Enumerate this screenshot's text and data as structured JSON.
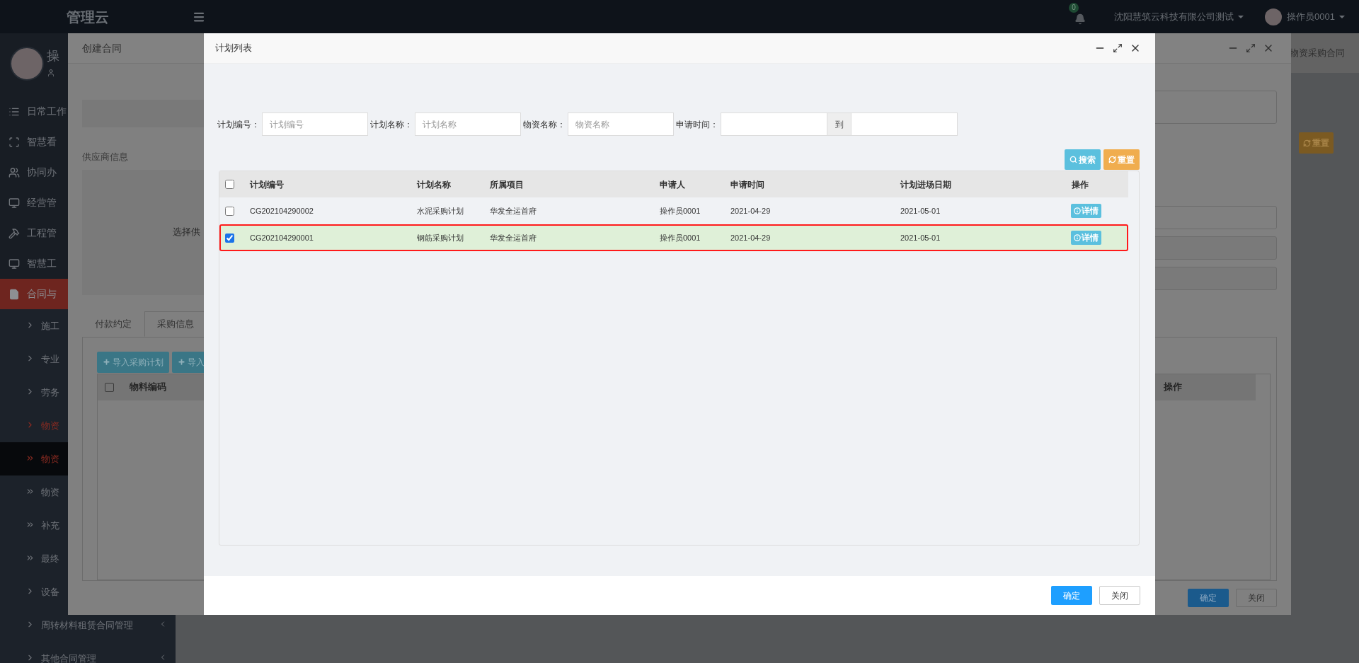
{
  "header": {
    "logo": "管理云",
    "notification_count": "0",
    "company": "沈阳慧筑云科技有限公司测试",
    "user": "操作员0001"
  },
  "sidebar": {
    "profile_name": "操",
    "items": [
      {
        "label": "日常工作",
        "selected": false
      },
      {
        "label": "智慧看",
        "selected": false
      },
      {
        "label": "协同办",
        "selected": false
      },
      {
        "label": "经营管",
        "selected": false
      },
      {
        "label": "工程管",
        "selected": false
      },
      {
        "label": "智慧工",
        "selected": false
      },
      {
        "label": "合同与",
        "selected": true,
        "children": [
          {
            "label": "施工",
            "kind": "folder",
            "highlighted": false,
            "selected": false
          },
          {
            "label": "专业",
            "kind": "folder",
            "highlighted": false,
            "selected": false
          },
          {
            "label": "劳务",
            "kind": "folder",
            "highlighted": false,
            "selected": false
          },
          {
            "label": "物资",
            "kind": "folder",
            "highlighted": true,
            "selected": false
          },
          {
            "label": "物资",
            "kind": "link",
            "highlighted": true,
            "selected": true
          },
          {
            "label": "物资",
            "kind": "link",
            "highlighted": false,
            "selected": false
          },
          {
            "label": "补充",
            "kind": "link",
            "highlighted": false,
            "selected": false
          },
          {
            "label": "最终",
            "kind": "link",
            "highlighted": false,
            "selected": false
          },
          {
            "label": "设备",
            "kind": "folder",
            "highlighted": false,
            "selected": false
          },
          {
            "label": "周转材料租赁合同管理",
            "kind": "folder",
            "highlighted": false,
            "selected": false
          },
          {
            "label": "其他合同管理",
            "kind": "folder",
            "highlighted": false,
            "selected": false
          }
        ]
      }
    ]
  },
  "page": {
    "tab_label": "物资采购合同",
    "reset_button": "重置"
  },
  "create_dialog": {
    "title": "创建合同",
    "supplier_section": "供应商信息",
    "supplier_label": "选择供",
    "tabs": [
      {
        "label": "付款约定",
        "selected": false
      },
      {
        "label": "采购信息",
        "selected": true
      }
    ],
    "buttons": [
      "导入采购计划",
      "导入"
    ],
    "header_checked": false,
    "table_columns": [
      "物料编码",
      "操作"
    ],
    "footer_buttons": [
      {
        "label": "确定",
        "kind": "primary"
      },
      {
        "label": "关闭",
        "kind": "default"
      }
    ]
  },
  "plan_dialog": {
    "title": "计划列表",
    "filters": [
      {
        "label": "计划编号：",
        "kind": "text",
        "placeholder": "计划编号"
      },
      {
        "label": "计划名称：",
        "kind": "text",
        "placeholder": "计划名称"
      },
      {
        "label": "物资名称：",
        "kind": "text",
        "placeholder": "物资名称"
      },
      {
        "label": "申请时间：",
        "kind": "range",
        "separator": "到"
      }
    ],
    "buttons": [
      {
        "label": "搜索",
        "kind": "search"
      },
      {
        "label": "重置",
        "kind": "reset"
      }
    ],
    "table": {
      "header_checked": false,
      "columns": [
        "计划编号",
        "计划名称",
        "所属项目",
        "申请人",
        "申请时间",
        "计划进场日期",
        "操作"
      ],
      "rows": [
        {
          "checked": false,
          "selected": false,
          "cells": [
            "CG202104290002",
            "水泥采购计划",
            "华发全运首府",
            "操作员0001",
            "2021-04-29",
            "2021-05-01"
          ],
          "action": "详情"
        },
        {
          "checked": true,
          "selected": true,
          "cells": [
            "CG202104290001",
            "钢筋采购计划",
            "华发全运首府",
            "操作员0001",
            "2021-04-29",
            "2021-05-01"
          ],
          "action": "详情"
        }
      ]
    },
    "footer_buttons": [
      {
        "label": "确定",
        "kind": "primary"
      },
      {
        "label": "关闭",
        "kind": "default"
      }
    ]
  }
}
